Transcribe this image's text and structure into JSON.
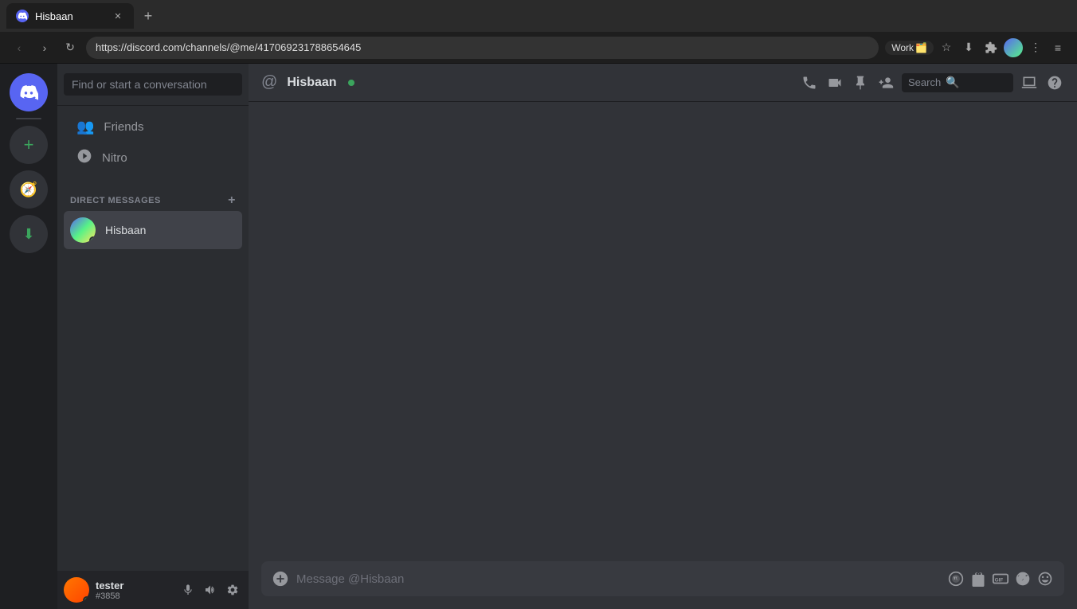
{
  "browser": {
    "tab_label": "Hisbaan",
    "tab_favicon": "🎮",
    "url": "https://discord.com/channels/@me/417069231788654645",
    "back_btn": "‹",
    "forward_btn": "›",
    "reload_btn": "↻",
    "work_label": "Work",
    "work_icon": "🗂️",
    "actions": {
      "star": "☆",
      "download": "⬇",
      "extensions": "☰",
      "profile": "👤",
      "more": "⋮",
      "menu": "≡"
    }
  },
  "server_sidebar": {
    "discord_icon": "🎮",
    "add_server_icon": "+",
    "explore_icon": "🧭",
    "download_icon": "⬇"
  },
  "dm_sidebar": {
    "search_placeholder": "Find or start a conversation",
    "friends_label": "Friends",
    "nitro_label": "Nitro",
    "section_label": "DIRECT MESSAGES",
    "dm_items": [
      {
        "username": "Hisbaan",
        "avatar_colors": [
          "#5865F2",
          "#57F287",
          "#FEE75C"
        ],
        "online": true
      }
    ],
    "footer": {
      "username": "tester",
      "discriminator": "#3858",
      "mute_icon": "🎤",
      "deafen_icon": "🔊",
      "settings_icon": "⚙"
    }
  },
  "chat": {
    "header": {
      "icon": "@",
      "username": "Hisbaan",
      "online": true,
      "actions": {
        "call_icon": "📞",
        "video_icon": "📹",
        "pin_icon": "📌",
        "add_friend_icon": "➕",
        "search_placeholder": "Search",
        "layout_icon": "▣",
        "help_icon": "?"
      }
    },
    "input_placeholder": "Message @Hisbaan",
    "input_actions": {
      "add_icon": "+",
      "gif_label": "GIF",
      "sticker_icon": "🗒",
      "emoji_icon": "😊",
      "nitro_icon": "🎮",
      "gift_icon": "🎁"
    }
  }
}
